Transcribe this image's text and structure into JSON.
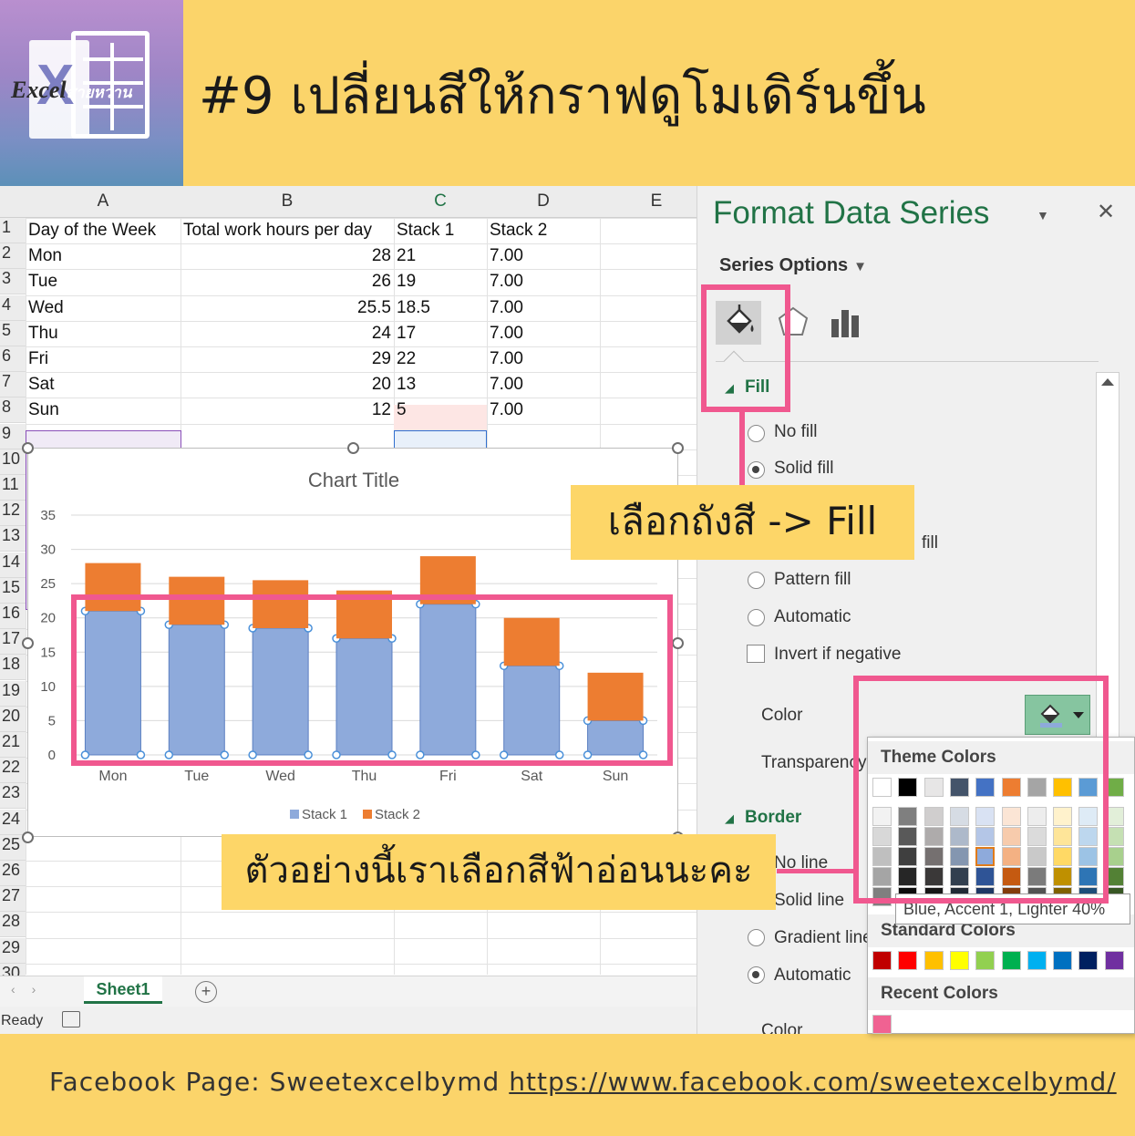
{
  "header": {
    "logo_text": "Excel",
    "logo_thai": "สายหวาน",
    "headline": "#9 เปลี่ยนสีให้กราฟดูโมเดิร์นขึ้น"
  },
  "sheet": {
    "columns": [
      "A",
      "B",
      "C",
      "D",
      "E"
    ],
    "row_numbers": [
      "1",
      "2",
      "3",
      "4",
      "5",
      "6",
      "7",
      "8",
      "9",
      "10",
      "11",
      "12",
      "13",
      "14",
      "15",
      "16",
      "17",
      "18",
      "19",
      "20",
      "21",
      "22",
      "23",
      "24",
      "25",
      "26",
      "27",
      "28",
      "29",
      "30"
    ],
    "headers": [
      "Day of the Week",
      "Total work hours per day",
      "Stack 1",
      "Stack 2"
    ],
    "rows": [
      [
        "Mon",
        "28",
        "21",
        "7.00"
      ],
      [
        "Tue",
        "26",
        "19",
        "7.00"
      ],
      [
        "Wed",
        "25.5",
        "18.5",
        "7.00"
      ],
      [
        "Thu",
        "24",
        "17",
        "7.00"
      ],
      [
        "Fri",
        "29",
        "22",
        "7.00"
      ],
      [
        "Sat",
        "20",
        "13",
        "7.00"
      ],
      [
        "Sun",
        "12",
        "5",
        "7.00"
      ]
    ],
    "tab": "Sheet1",
    "status": "Ready"
  },
  "chart_data": {
    "type": "bar",
    "stacked": true,
    "title": "Chart Title",
    "categories": [
      "Mon",
      "Tue",
      "Wed",
      "Thu",
      "Fri",
      "Sat",
      "Sun"
    ],
    "series": [
      {
        "name": "Stack 1",
        "values": [
          21,
          19,
          18.5,
          17,
          22,
          13,
          5
        ],
        "color": "#8eaadb"
      },
      {
        "name": "Stack 2",
        "values": [
          7,
          7,
          7,
          7,
          7,
          7,
          7
        ],
        "color": "#ed7d31"
      }
    ],
    "ylim": [
      0,
      35
    ],
    "yticks": [
      0,
      5,
      10,
      15,
      20,
      25,
      30,
      35
    ],
    "grid": true,
    "legend": "bottom"
  },
  "pane": {
    "title": "Format Data Series",
    "series_options": "Series Options",
    "fill_section": "Fill",
    "fill_options": [
      "No fill",
      "Solid fill",
      "fill",
      "Pattern fill",
      "Automatic"
    ],
    "invert": "Invert if negative",
    "color_label": "Color",
    "transparency_label": "Transparency",
    "border_section": "Border",
    "border_options": [
      "No line",
      "Solid line",
      "Gradient line",
      "Automatic"
    ],
    "color_label_2": "Color"
  },
  "color_popup": {
    "theme_title": "Theme Colors",
    "standard_title": "Standard Colors",
    "recent_title": "Recent Colors",
    "tooltip": "Blue, Accent 1, Lighter 40%",
    "theme_top": [
      "#ffffff",
      "#000000",
      "#e7e6e6",
      "#44546a",
      "#4472c4",
      "#ed7d31",
      "#a5a5a5",
      "#ffc000",
      "#5b9bd5",
      "#70ad47"
    ],
    "theme_shades": [
      [
        "#f2f2f2",
        "#7f7f7f",
        "#d0cece",
        "#d6dce4",
        "#d9e2f3",
        "#fbe5d5",
        "#ededed",
        "#fff2cc",
        "#deebf6",
        "#e2efd9"
      ],
      [
        "#d8d8d8",
        "#595959",
        "#aeabab",
        "#adb9ca",
        "#b4c6e7",
        "#f7cbac",
        "#dbdbdb",
        "#fee599",
        "#bdd7ee",
        "#c5e0b3"
      ],
      [
        "#bfbfbf",
        "#3f3f3f",
        "#757070",
        "#8496b0",
        "#8eaadb",
        "#f4b183",
        "#c9c9c9",
        "#ffd965",
        "#9cc3e5",
        "#a8d08d"
      ],
      [
        "#a5a5a5",
        "#262626",
        "#3a3838",
        "#323f4f",
        "#2f5496",
        "#c55a11",
        "#7b7b7b",
        "#bf9000",
        "#2e75b5",
        "#538135"
      ],
      [
        "#7f7f7f",
        "#0c0c0c",
        "#171616",
        "#222a35",
        "#1f3864",
        "#833c0b",
        "#525252",
        "#7f6000",
        "#1e4e79",
        "#375623"
      ]
    ],
    "standard": [
      "#c00000",
      "#ff0000",
      "#ffc000",
      "#ffff00",
      "#92d050",
      "#00b050",
      "#00b0f0",
      "#0070c0",
      "#002060",
      "#7030a0"
    ],
    "recent": [
      "#f06292"
    ]
  },
  "callouts": {
    "fill": "เลือกถังสี -> Fill",
    "color": "ตัวอย่างนี้เราเลือกสีฟ้าอ่อนนะคะ"
  },
  "footer": {
    "label": "Facebook Page: Sweetexcelbymd",
    "url": "https://www.facebook.com/sweetexcelbymd/"
  },
  "colors": {
    "accent_pink": "#f0588f",
    "callout_yellow": "#fdd668",
    "excel_green": "#217346"
  }
}
